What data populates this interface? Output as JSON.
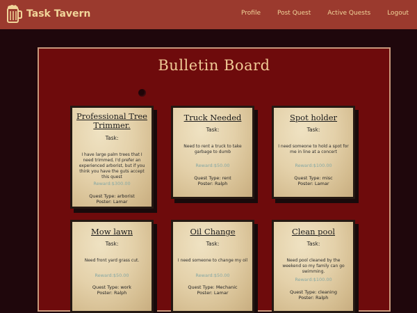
{
  "header": {
    "brand": "Task Tavern",
    "logo_icon": "beer-mug-icon",
    "nav": [
      "Profile",
      "Post Quest",
      "Active Quests",
      "Logout"
    ]
  },
  "board": {
    "title": "Bulletin Board"
  },
  "quests": [
    {
      "title": "Professional Tree Trimmer.",
      "task_label": "Task:",
      "description": "I have large palm trees that I need trimmed, I'd prefer an experienced arborist, but if you think you have the guts accept this quest",
      "reward": "Reward:$300.00",
      "type": "Quest Type: arborist",
      "poster": "Poster: Lamar"
    },
    {
      "title": "Truck Needed",
      "task_label": "Task:",
      "description": "Need to rent a truck to take garbage to dumb",
      "reward": "Reward:$50.00",
      "type": "Quest Type: rent",
      "poster": "Poster: Ralph"
    },
    {
      "title": "Spot holder",
      "task_label": "Task:",
      "description": "I need someone to hold a spot for me in line at a concert",
      "reward": "Reward:$100.00",
      "type": "Quest Type: misc",
      "poster": "Poster: Lamar"
    },
    {
      "title": "Mow lawn",
      "task_label": "Task:",
      "description": "Need front yard grass cut.",
      "reward": "Reward:$50.00",
      "type": "Quest Type: work",
      "poster": "Poster: Ralph"
    },
    {
      "title": "Oil Change",
      "task_label": "Task:",
      "description": "I need someone to change my oil",
      "reward": "Reward:$50.00",
      "type": "Quest Type: Mechanic",
      "poster": "Poster: Lamar"
    },
    {
      "title": "Clean pool",
      "task_label": "Task:",
      "description": "Need pool cleaned by the weekend so my family can go swimming.",
      "reward": "Reward:$100.00",
      "type": "Quest Type: cleaning",
      "poster": "Poster: Ralph"
    }
  ]
}
